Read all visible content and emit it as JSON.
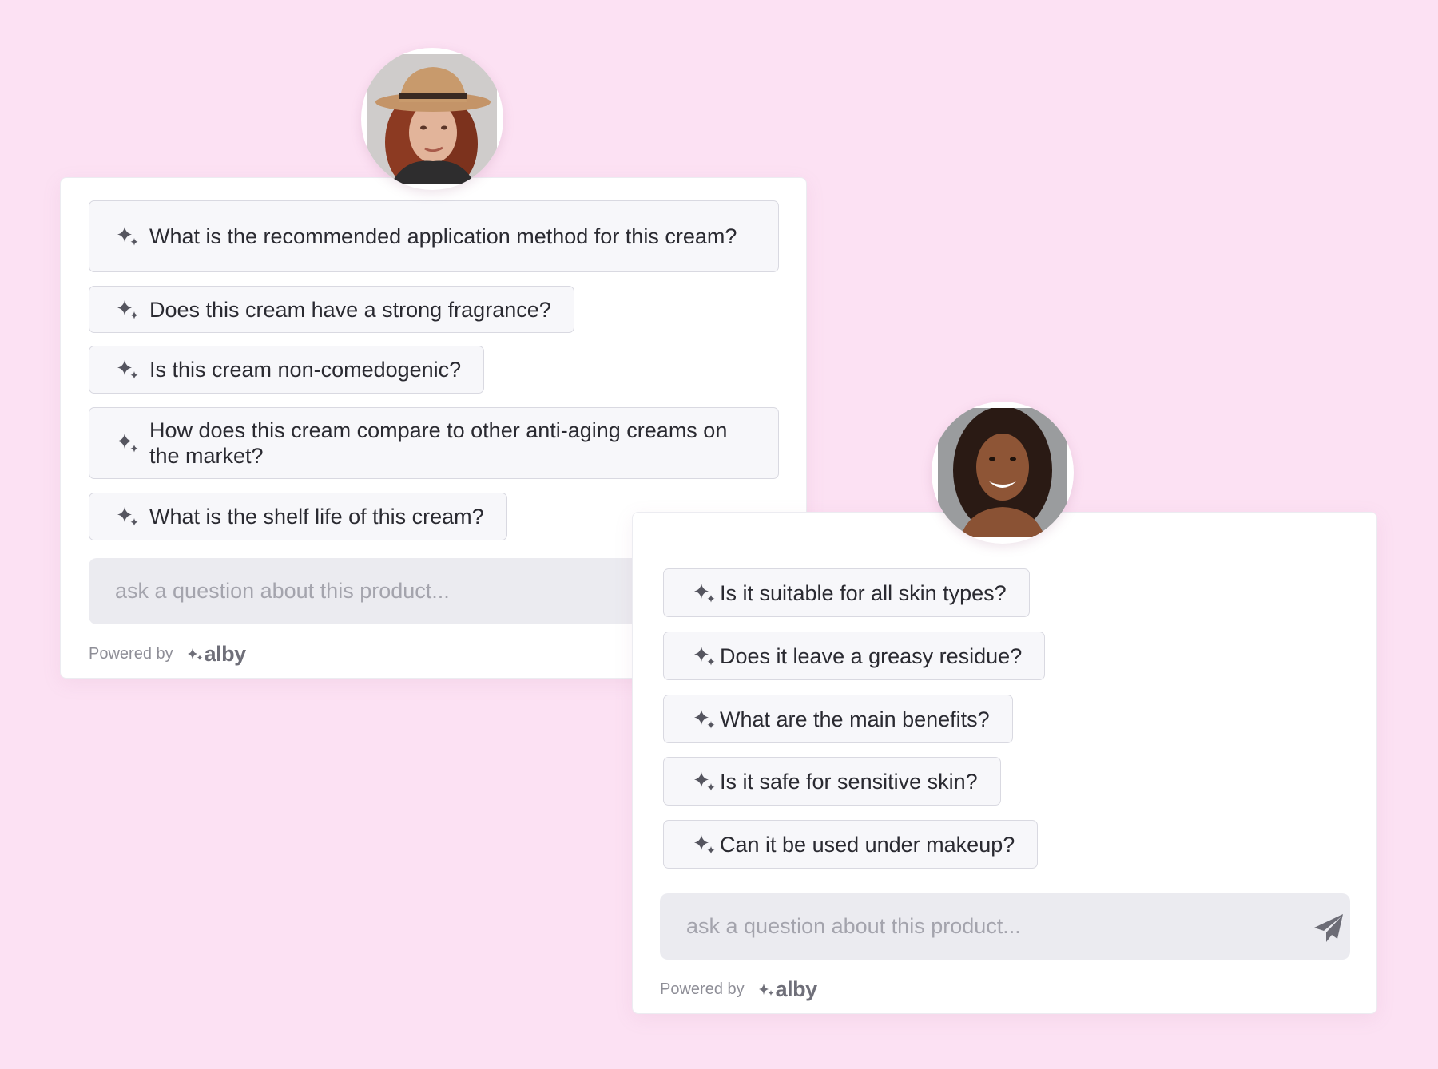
{
  "colors": {
    "background": "#fce1f3",
    "card": "#ffffff",
    "chip_background": "#f7f7fa",
    "chip_border": "#d9d9e1",
    "input_background": "#ebebf0",
    "placeholder": "#a4a4ad",
    "icon": "#55555f"
  },
  "widget_a": {
    "avatar_icon": "profile-photo",
    "questions": [
      {
        "icon": "sparkle-icon",
        "label": "What is the recommended application method for this cream?"
      },
      {
        "icon": "sparkle-icon",
        "label": "Does this cream have a strong fragrance?"
      },
      {
        "icon": "sparkle-icon",
        "label": "Is this cream non-comedogenic?"
      },
      {
        "icon": "sparkle-icon",
        "label": "How does this cream compare to other anti-aging creams on the market?"
      },
      {
        "icon": "sparkle-icon",
        "label": "What is the shelf life of this cream?"
      }
    ],
    "input": {
      "value": "",
      "placeholder": "ask a question about this product..."
    },
    "powered_by": "Powered by",
    "brand": "alby"
  },
  "widget_b": {
    "avatar_icon": "profile-photo",
    "questions": [
      {
        "icon": "sparkle-icon",
        "label": "Is it suitable for all skin types?"
      },
      {
        "icon": "sparkle-icon",
        "label": "Does it leave a greasy residue?"
      },
      {
        "icon": "sparkle-icon",
        "label": "What are the main benefits?"
      },
      {
        "icon": "sparkle-icon",
        "label": "Is it safe for sensitive skin?"
      },
      {
        "icon": "sparkle-icon",
        "label": "Can it be used under makeup?"
      }
    ],
    "input": {
      "value": "",
      "placeholder": "ask a question about this product..."
    },
    "send_icon": "send-icon",
    "powered_by": "Powered by",
    "brand": "alby"
  }
}
